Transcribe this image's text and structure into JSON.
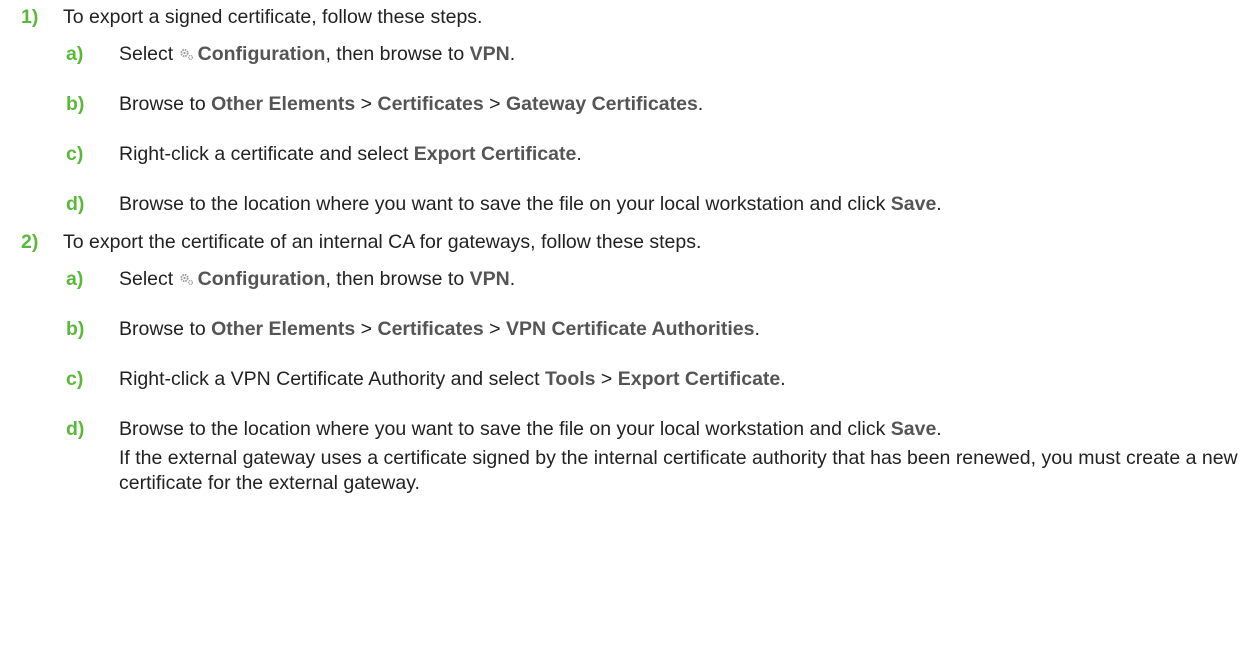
{
  "steps": [
    {
      "number": "1)",
      "text": "To export a signed certificate, follow these steps.",
      "substeps": [
        {
          "letter": "a)",
          "parts": [
            {
              "t": "Select "
            },
            {
              "icon": "gear-icon"
            },
            {
              "t": "Configuration",
              "ui": true
            },
            {
              "t": ", then browse to "
            },
            {
              "t": "VPN",
              "ui": true
            },
            {
              "t": "."
            }
          ]
        },
        {
          "letter": "b)",
          "parts": [
            {
              "t": "Browse to "
            },
            {
              "t": "Other Elements",
              "ui": true
            },
            {
              "t": " > "
            },
            {
              "t": "Certificates",
              "ui": true
            },
            {
              "t": " > "
            },
            {
              "t": "Gateway Certificates",
              "ui": true
            },
            {
              "t": "."
            }
          ]
        },
        {
          "letter": "c)",
          "parts": [
            {
              "t": "Right-click a certificate and select "
            },
            {
              "t": "Export Certificate",
              "ui": true
            },
            {
              "t": "."
            }
          ]
        },
        {
          "letter": "d)",
          "parts": [
            {
              "t": "Browse to the location where you want to save the file on your local workstation and click "
            },
            {
              "t": "Save",
              "ui": true
            },
            {
              "t": "."
            }
          ]
        }
      ]
    },
    {
      "number": "2)",
      "text": "To export the certificate of an internal CA for gateways, follow these steps.",
      "substeps": [
        {
          "letter": "a)",
          "parts": [
            {
              "t": "Select "
            },
            {
              "icon": "gear-icon"
            },
            {
              "t": "Configuration",
              "ui": true
            },
            {
              "t": ", then browse to "
            },
            {
              "t": "VPN",
              "ui": true
            },
            {
              "t": "."
            }
          ]
        },
        {
          "letter": "b)",
          "parts": [
            {
              "t": "Browse to "
            },
            {
              "t": "Other Elements",
              "ui": true
            },
            {
              "t": " > "
            },
            {
              "t": "Certificates",
              "ui": true
            },
            {
              "t": " > "
            },
            {
              "t": "VPN Certificate Authorities",
              "ui": true
            },
            {
              "t": "."
            }
          ]
        },
        {
          "letter": "c)",
          "parts": [
            {
              "t": "Right-click a VPN Certificate Authority and select "
            },
            {
              "t": "Tools",
              "ui": true
            },
            {
              "t": " > "
            },
            {
              "t": "Export Certificate",
              "ui": true
            },
            {
              "t": "."
            }
          ]
        },
        {
          "letter": "d)",
          "parts": [
            {
              "t": "Browse to the location where you want to save the file on your local workstation and click "
            },
            {
              "t": "Save",
              "ui": true
            },
            {
              "t": "."
            }
          ],
          "note": "If the external gateway uses a certificate signed by the internal certificate authority that has been renewed, you must create a new certificate for the external gateway."
        }
      ]
    }
  ],
  "colors": {
    "step_number": "#5cb83a",
    "ui_term": "#555555",
    "body_text": "#222222",
    "icon": "#9a9a9a"
  }
}
